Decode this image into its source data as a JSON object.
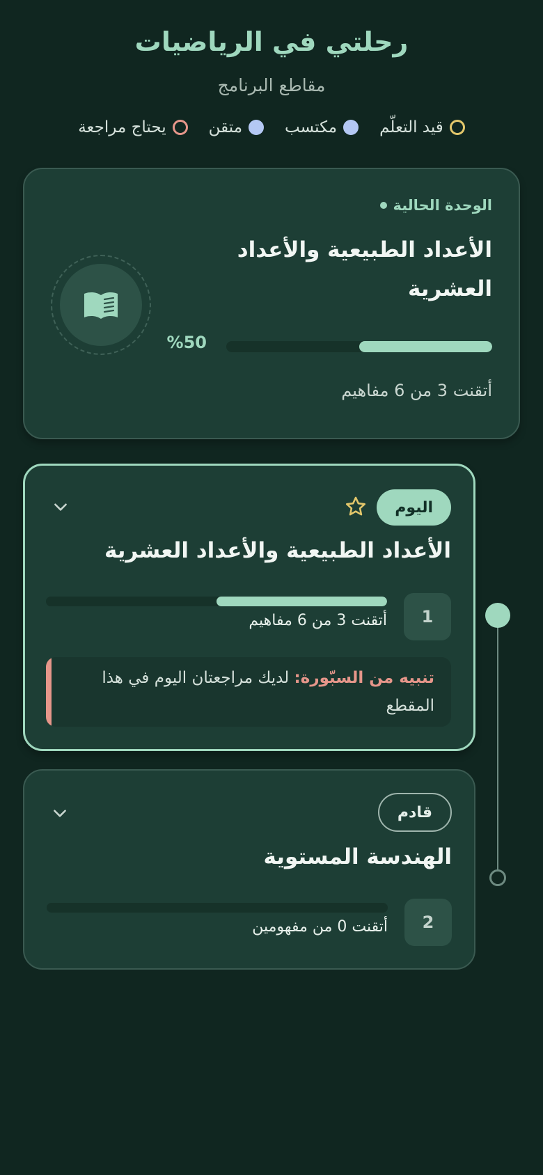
{
  "header": {
    "title": "رحلتي في الرياضيات",
    "subtitle": "مقاطع البرنامج"
  },
  "legend": {
    "learning": "قيد التعلّم",
    "acquired": "مكتسب",
    "mastered": "متقن",
    "review": "يحتاج مراجعة"
  },
  "colors": {
    "accent": "#9fd8be",
    "learning": "#e3c76b",
    "acquired": "#b4c8f4",
    "review": "#e6968a"
  },
  "current_unit": {
    "label": "الوحدة الحالية",
    "title": "الأعداد الطبيعية والأعداد العشرية",
    "progress_percent": 50,
    "progress_label": "%50",
    "summary": "أتقنت 3 من 6 مفاهيم",
    "icon": "book-icon"
  },
  "segments": [
    {
      "badge": "اليوم",
      "title": "الأعداد الطبيعية والأعداد العشرية",
      "number": "1",
      "progress_percent": 50,
      "summary": "أتقنت 3 من 6 مفاهيم",
      "warning_strong": "تنبيه من السبّورة:",
      "warning_text": " لديك مراجعتان اليوم في هذا المقطع",
      "starred": true
    },
    {
      "badge": "قادم",
      "title": "الهندسة المستوية",
      "number": "2",
      "progress_percent": 0,
      "summary": "أتقنت 0 من مفهومين"
    }
  ]
}
